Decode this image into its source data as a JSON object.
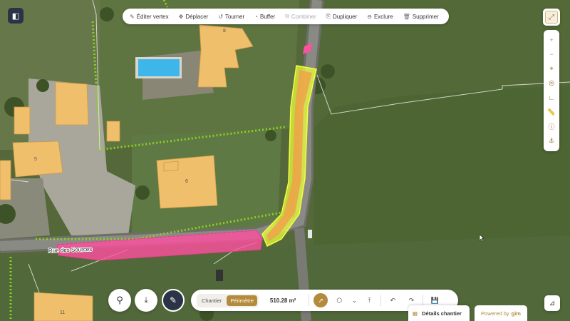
{
  "toolbar": {
    "items": [
      {
        "label": "Éditer vertex",
        "icon": "pencil-icon",
        "disabled": false
      },
      {
        "label": "Déplacer",
        "icon": "move-icon",
        "disabled": false
      },
      {
        "label": "Tourner",
        "icon": "rotate-icon",
        "disabled": false
      },
      {
        "label": "Buffer",
        "icon": "buffer-icon",
        "disabled": false
      },
      {
        "label": "Combiner",
        "icon": "combine-icon",
        "disabled": true
      },
      {
        "label": "Dupliquer",
        "icon": "duplicate-icon",
        "disabled": false
      },
      {
        "label": "Exclure",
        "icon": "exclude-icon",
        "disabled": false
      },
      {
        "label": "Supprimer",
        "icon": "trash-icon",
        "disabled": false
      }
    ]
  },
  "map": {
    "street_name": "Rue des Sources",
    "building_numbers": [
      "8",
      "5",
      "6",
      "11"
    ]
  },
  "bottom_bar": {
    "segment": {
      "options": [
        "Chantier",
        "Périmètre"
      ],
      "active": "Périmètre"
    },
    "area": "510.28 m²"
  },
  "details_tab": {
    "label": "Détails chantier"
  },
  "powered_by": {
    "prefix": "Powered by",
    "brand": "gim"
  },
  "colors": {
    "accent": "#b48a3c",
    "dark": "#2b3446",
    "perimeter_fill": "#e8ff3c",
    "chantier_fill": "#ff4fa0",
    "building_fill": "#f0bf6c"
  }
}
